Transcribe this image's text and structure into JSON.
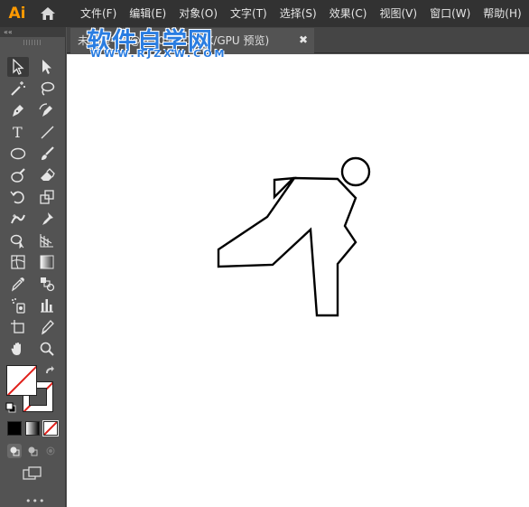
{
  "app": {
    "logo": "Ai"
  },
  "menu": [
    "文件(F)",
    "编辑(E)",
    "对象(O)",
    "文字(T)",
    "选择(S)",
    "效果(C)",
    "视图(V)",
    "窗口(W)",
    "帮助(H)"
  ],
  "document_tab": {
    "title": "未标题-1* @ 150% (CMYK/GPU 预览)",
    "close_symbol": "✖"
  },
  "watermark": {
    "title": "软件自学网",
    "url": "WWW.RJZXW.COM"
  },
  "panel": {
    "collapse_symbol": "««",
    "more_symbol": "•••"
  },
  "tools": [
    "selection-tool",
    "direct-selection-tool",
    "magic-wand-tool",
    "lasso-tool",
    "pen-tool",
    "curvature-tool",
    "type-tool",
    "line-segment-tool",
    "ellipse-tool",
    "paintbrush-tool",
    "blob-brush-tool",
    "eraser-tool",
    "rotate-tool",
    "scale-tool",
    "width-tool",
    "puppet-warp-tool",
    "shape-builder-tool",
    "perspective-grid-tool",
    "mesh-tool",
    "gradient-tool",
    "eyedropper-tool",
    "blend-tool",
    "symbol-sprayer-tool",
    "column-graph-tool",
    "artboard-tool",
    "slice-tool",
    "hand-tool",
    "zoom-tool"
  ],
  "colors": {
    "accent": "#ff9a00",
    "watermark": "#2a7de1",
    "none_slash": "#e0201b"
  }
}
